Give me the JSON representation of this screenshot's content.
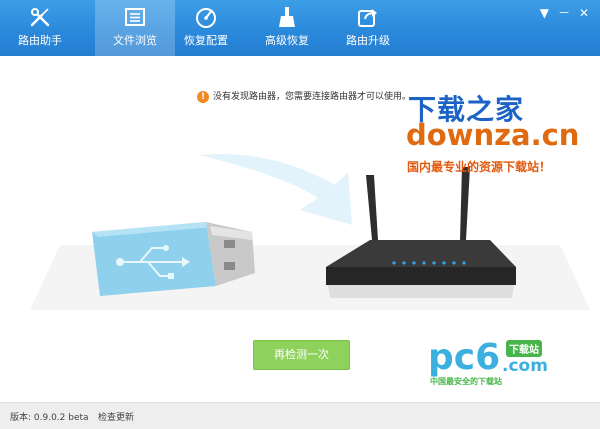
{
  "tabs": [
    {
      "label": "路由助手",
      "icon": "wrench-screwdriver-icon"
    },
    {
      "label": "文件浏览",
      "icon": "file-list-icon"
    },
    {
      "label": "恢复配置",
      "icon": "restore-gauge-icon"
    },
    {
      "label": "高级恢复",
      "icon": "broom-icon"
    },
    {
      "label": "路由升级",
      "icon": "upgrade-arrow-icon"
    }
  ],
  "active_tab": 1,
  "window_controls": {
    "menu": "▼",
    "minimize": "－",
    "close": "✕"
  },
  "notice": {
    "icon": "!",
    "text": "没有发现路由器，您需要连接路由器才可以使用。"
  },
  "watermark": {
    "line1": "下载之家",
    "line2": "downza.cn",
    "line3": "国内最专业的资源下载站！"
  },
  "recheck_button": "再检测一次",
  "pc6_logo": {
    "main": "pc6",
    "com": ".com",
    "tag": "下载站",
    "sub": "中国最安全的下载站"
  },
  "footer": {
    "version": "版本: 0.9.0.2 beta",
    "check_update": "检查更新"
  },
  "colors": {
    "titlebar": "#2a88da",
    "recheck": "#8ed25c",
    "usb": "#8fd0ec",
    "router": "#2e2e2e",
    "router_led": "#2ea8ea"
  }
}
